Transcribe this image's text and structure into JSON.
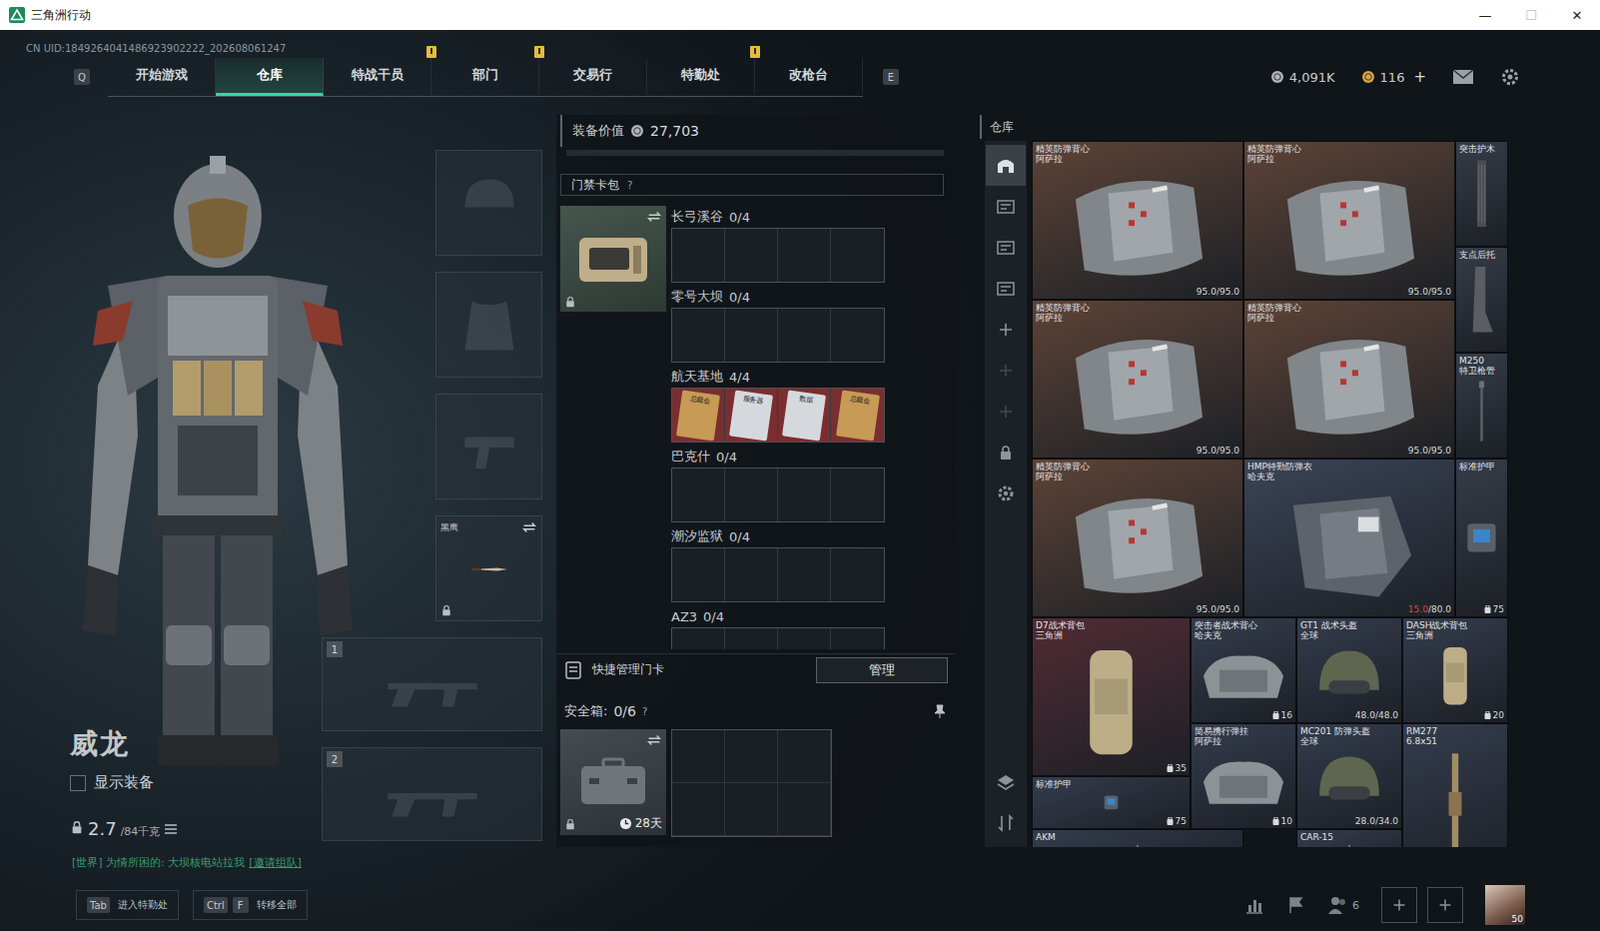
{
  "window": {
    "title": "三角洲行动",
    "controls": [
      {
        "glyph": "—",
        "disabled": false
      },
      {
        "glyph": "☐",
        "disabled": true
      },
      {
        "glyph": "✕",
        "disabled": false
      }
    ]
  },
  "uid": "CN UID:1849264041486923902222_202608061247",
  "nav": {
    "key_left": "Q",
    "key_right": "E",
    "tabs": [
      {
        "label": "开始游戏",
        "selected": false,
        "alert": false
      },
      {
        "label": "仓库",
        "selected": true,
        "alert": false
      },
      {
        "label": "特战干员",
        "selected": false,
        "alert": true
      },
      {
        "label": "部门",
        "selected": false,
        "alert": true
      },
      {
        "label": "交易行",
        "selected": false,
        "alert": false
      },
      {
        "label": "特勤处",
        "selected": false,
        "alert": true
      },
      {
        "label": "改枪台",
        "selected": false,
        "alert": false
      }
    ]
  },
  "currency": [
    {
      "kind": "silver",
      "amount": "4,091K"
    },
    {
      "kind": "gold",
      "amount": "116",
      "plus": "+"
    }
  ],
  "operator": {
    "name": "威龙",
    "show_gear": {
      "label": "显示装备",
      "checked": false
    },
    "weight": {
      "value": "2.7",
      "max": "/84千克"
    }
  },
  "chat": {
    "text": "[世界] 为情所困的: 大坝核电站拉我",
    "link": "[邀请组队]"
  },
  "slots": [
    {
      "kind": "helmet"
    },
    {
      "kind": "armor"
    },
    {
      "kind": "pistol"
    },
    {
      "kind": "melee",
      "label": "黑鹰",
      "locked": true
    },
    {
      "kind": "primary",
      "number": "1"
    },
    {
      "kind": "primary",
      "number": "2"
    }
  ],
  "loadout": {
    "label": "装备价值",
    "value": "27,703"
  },
  "keycard_case": {
    "title": "门禁卡包",
    "help": "?",
    "locked": true,
    "maps": [
      {
        "name": "长弓溪谷",
        "count": "0/4",
        "cards": []
      },
      {
        "name": "零号大坝",
        "count": "0/4",
        "cards": []
      },
      {
        "name": "航天基地",
        "count": "4/4",
        "cards": [
          {
            "label": "总裁会",
            "color": "#c79a55"
          },
          {
            "label": "服务器",
            "color": "#d5d9de"
          },
          {
            "label": "数据",
            "color": "#d5d9de"
          },
          {
            "label": "总裁会",
            "color": "#c79a55"
          }
        ]
      },
      {
        "name": "巴克什",
        "count": "0/4",
        "cards": []
      },
      {
        "name": "潮汐监狱",
        "count": "0/4",
        "cards": []
      },
      {
        "name": "AZ3",
        "count": "0/4",
        "cards": []
      }
    ]
  },
  "quick_manage": {
    "label": "快捷管理门卡",
    "button": "管理"
  },
  "safebox": {
    "label": "安全箱:",
    "count": "0/6",
    "help": "?",
    "days": "28天",
    "locked": true
  },
  "stash": {
    "title": "仓库",
    "sidebar": [
      {
        "kind": "all",
        "selected": true,
        "disabled": false
      },
      {
        "kind": "list",
        "selected": false,
        "disabled": false
      },
      {
        "kind": "list",
        "selected": false,
        "disabled": false
      },
      {
        "kind": "list",
        "selected": false,
        "disabled": false
      },
      {
        "kind": "add",
        "selected": false,
        "disabled": false
      },
      {
        "kind": "add",
        "selected": false,
        "disabled": true
      },
      {
        "kind": "add",
        "selected": false,
        "disabled": true
      },
      {
        "kind": "lock",
        "selected": false,
        "disabled": false
      },
      {
        "kind": "settings",
        "selected": false,
        "disabled": false
      }
    ],
    "sidebar_bottom": [
      {
        "kind": "layers"
      },
      {
        "kind": "sort"
      }
    ],
    "items": [
      {
        "name": "精英防弹背心",
        "maker": "阿萨拉",
        "kind": "vest",
        "color": "#5d4336",
        "durability": {
          "current": "95.0",
          "sep": "/",
          "max": "95.0",
          "low": false
        }
      },
      {
        "name": "精英防弹背心",
        "maker": "阿萨拉",
        "kind": "vest",
        "color": "#5d4336",
        "durability": {
          "current": "95.0",
          "sep": "/",
          "max": "95.0",
          "low": false
        }
      },
      {
        "name": "突击护木",
        "kind": "handguard",
        "color": "#363c48"
      },
      {
        "name": "支点后托",
        "kind": "stock",
        "color": "#363c48"
      },
      {
        "name": "精英防弹背心",
        "maker": "阿萨拉",
        "kind": "vest",
        "color": "#5d4336",
        "durability": {
          "current": "95.0",
          "sep": "/",
          "max": "95.0",
          "low": false
        }
      },
      {
        "name": "精英防弹背心",
        "maker": "阿萨拉",
        "kind": "vest",
        "color": "#5d4336",
        "durability": {
          "current": "95.0",
          "sep": "/",
          "max": "95.0",
          "low": false
        }
      },
      {
        "name": "M250",
        "maker": "特卫枪管",
        "kind": "barrel",
        "color": "#363c48"
      },
      {
        "name": "精英防弹背心",
        "maker": "阿萨拉",
        "kind": "vest",
        "color": "#5d4336",
        "durability": {
          "current": "95.0",
          "sep": "/",
          "max": "95.0",
          "low": false
        }
      },
      {
        "name": "HMP特勤防弹衣",
        "maker": "哈夫克",
        "kind": "armor",
        "color": "#3b4457",
        "durability": {
          "current": "15.0",
          "sep": "/",
          "max": "80.0",
          "low": true
        }
      },
      {
        "name": "标准护甲",
        "kind": "plate",
        "color": "#363c48",
        "count": "75"
      },
      {
        "name": "D7战术背包",
        "maker": "三角洲",
        "kind": "backpack",
        "color": "#522b34",
        "count": "35"
      },
      {
        "name": "突击者战术背心",
        "maker": "哈夫克",
        "kind": "rig",
        "color": "#343c4d",
        "count": "16"
      },
      {
        "name": "GT1 战术头盔",
        "maker": "全球",
        "kind": "helmet",
        "color": "#343c4d",
        "durability": {
          "current": "48.0",
          "sep": "/",
          "max": "48.0",
          "low": false
        }
      },
      {
        "name": "DASH战术背包",
        "maker": "三角洲",
        "kind": "backpack",
        "color": "#343c4d",
        "count": "20"
      },
      {
        "name": "标准护甲",
        "kind": "plate",
        "color": "#343c4d",
        "count": "75"
      },
      {
        "name": "简易携行弹挂",
        "maker": "阿萨拉",
        "kind": "rig",
        "color": "#343c4d",
        "count": "10"
      },
      {
        "name": "MC201 防弹头盔",
        "maker": "全球",
        "kind": "helmet",
        "color": "#343c4d",
        "durability": {
          "current": "28.0",
          "sep": "/",
          "max": "34.0",
          "low": false
        }
      },
      {
        "name": "RM277",
        "maker": "6.8x51",
        "kind": "rifle",
        "color": "#343c4d"
      },
      {
        "name": "AKM",
        "kind": "rifle",
        "color": "#343c4d"
      },
      {
        "name": "CAR-15",
        "kind": "rifle",
        "color": "#343c4d"
      }
    ]
  },
  "hints": [
    {
      "keys": [
        "Tab"
      ],
      "label": "进入特勤处"
    },
    {
      "keys": [
        "Ctrl",
        "F"
      ],
      "label": "转移全部"
    }
  ],
  "squad": {
    "count": "6"
  },
  "avatar": {
    "level": "50"
  }
}
